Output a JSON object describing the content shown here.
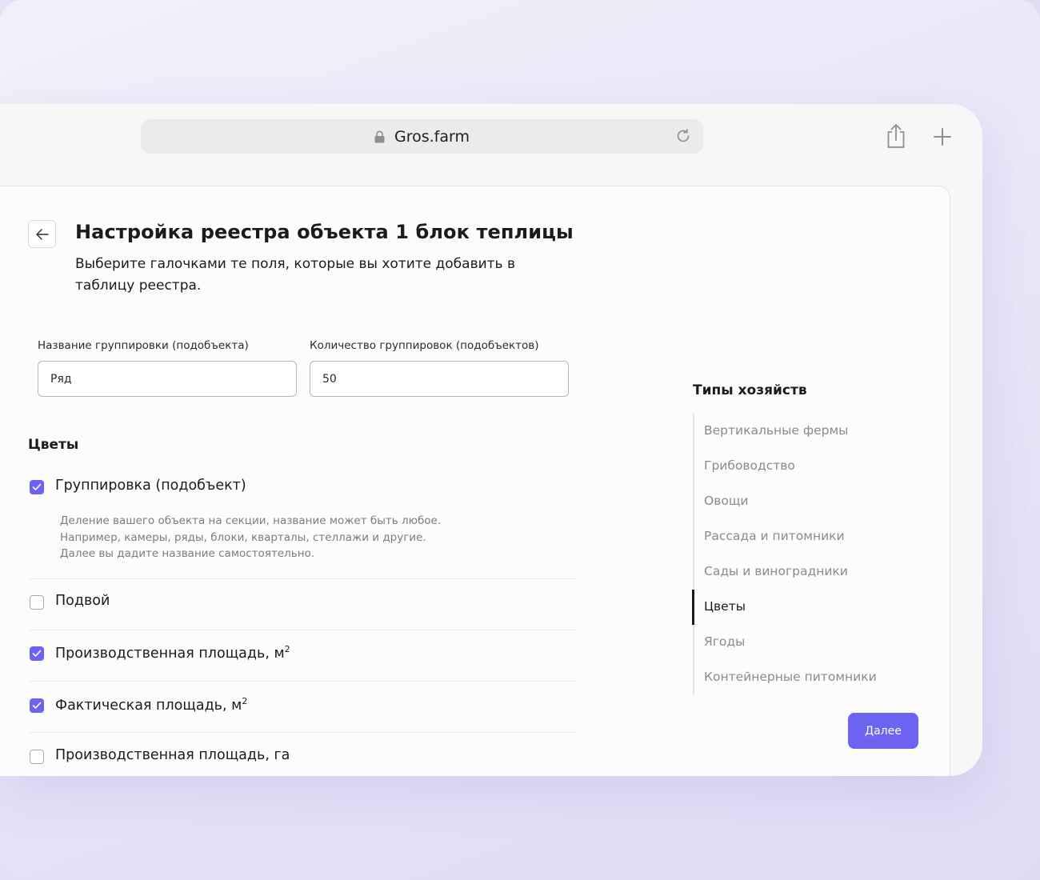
{
  "browser": {
    "url": "Gros.farm"
  },
  "page": {
    "title": "Настройка реестра объекта 1 блок теплицы",
    "subtitle": "Выберите галочками те поля, которые вы хотите добавить в таблицу реестра.",
    "group_name_label": "Название группировки (подобъекта)",
    "group_name_value": "Ряд",
    "group_count_label": "Количество группировок (подобъектов)",
    "group_count_value": "50",
    "section_title": "Цветы",
    "fields": [
      {
        "label": "Группировка (подобъект)",
        "checked": true,
        "sup": ""
      },
      {
        "label": "Подвой",
        "checked": false,
        "sup": ""
      },
      {
        "label": "Производственная площадь, м",
        "checked": true,
        "sup": "2"
      },
      {
        "label": "Фактическая площадь, м",
        "checked": true,
        "sup": "2"
      },
      {
        "label": "Производственная площадь, га",
        "checked": false,
        "sup": ""
      }
    ],
    "hint_lines": [
      "Деление вашего объекта на секции, название может быть любое.",
      "Например, камеры, ряды, блоки, кварталы, стеллажи и другие.",
      "Далее вы дадите название самостоятельно."
    ]
  },
  "types": {
    "title": "Типы хозяйств",
    "items": [
      "Вертикальные фермы",
      "Грибоводство",
      "Овощи",
      "Рассада и питомники",
      "Сады и виноградники",
      "Цветы",
      "Ягоды",
      "Контейнерные питомники"
    ],
    "active": "Цветы"
  },
  "next_button": "Далее",
  "colors": {
    "accent": "#6c63f0",
    "text": "#1b1b1f",
    "muted": "#8a8a91"
  }
}
